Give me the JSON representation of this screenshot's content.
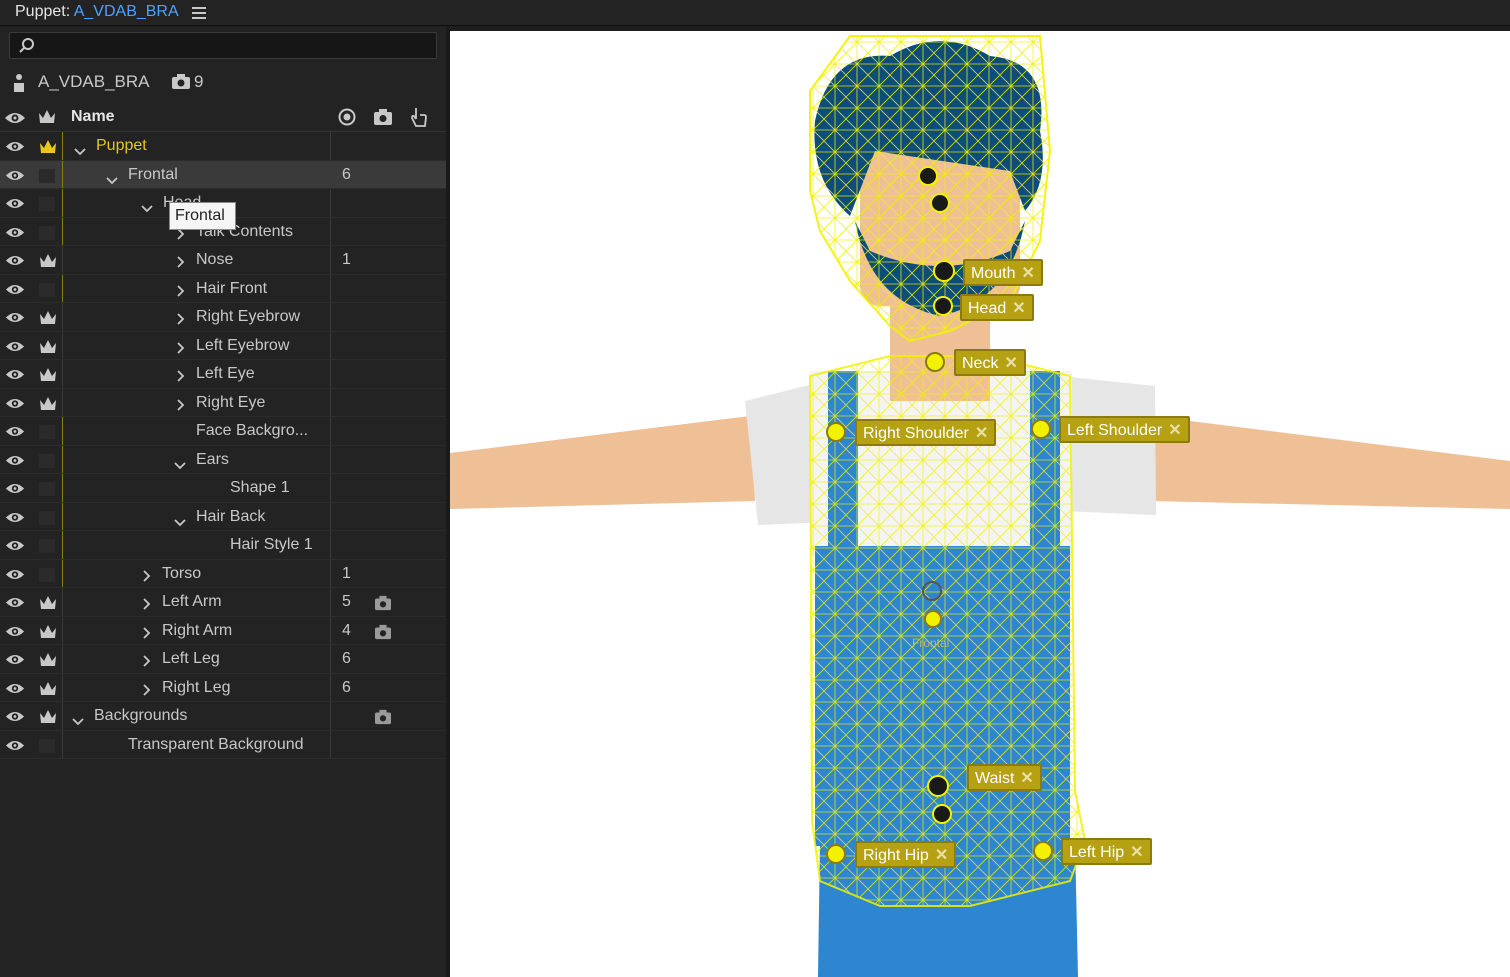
{
  "titlebar": {
    "prefix": "Puppet:",
    "puppet_name": "A_VDAB_BRA"
  },
  "search": {
    "placeholder": ""
  },
  "puppet_info": {
    "name": "A_VDAB_BRA",
    "camera_count": "9"
  },
  "header": {
    "name_label": "Name"
  },
  "rows": [
    {
      "label": "Puppet",
      "num": ""
    },
    {
      "label": "Frontal",
      "num": "6"
    },
    {
      "label": "Head",
      "num": ""
    },
    {
      "label": "Talk Contents",
      "num": ""
    },
    {
      "label": "Nose",
      "num": "1"
    },
    {
      "label": "Hair Front",
      "num": ""
    },
    {
      "label": "Right Eyebrow",
      "num": ""
    },
    {
      "label": "Left Eyebrow",
      "num": ""
    },
    {
      "label": "Left Eye",
      "num": ""
    },
    {
      "label": "Right Eye",
      "num": ""
    },
    {
      "label": "Face Backgro...",
      "num": ""
    },
    {
      "label": "Ears",
      "num": ""
    },
    {
      "label": "Shape 1",
      "num": ""
    },
    {
      "label": "Hair Back",
      "num": ""
    },
    {
      "label": "Hair Style 1",
      "num": ""
    },
    {
      "label": "Torso",
      "num": "1"
    },
    {
      "label": "Left Arm",
      "num": "5"
    },
    {
      "label": "Right Arm",
      "num": "4"
    },
    {
      "label": "Left Leg",
      "num": "6"
    },
    {
      "label": "Right Leg",
      "num": "6"
    },
    {
      "label": "Backgrounds",
      "num": ""
    },
    {
      "label": "Transparent Background",
      "num": ""
    }
  ],
  "tooltip": "Frontal",
  "handles": {
    "mouth": "Mouth",
    "head": "Head",
    "neck": "Neck",
    "right_shoulder": "Right Shoulder",
    "left_shoulder": "Left Shoulder",
    "waist": "Waist",
    "right_hip": "Right Hip",
    "left_hip": "Left Hip",
    "close_glyph": "✕"
  },
  "scene_labels": {
    "frontal": "Frontal"
  },
  "colors": {
    "accent_yellow": "#e8c61a",
    "link_blue": "#4aa3ff",
    "mesh": "#f2f200",
    "overalls": "#2d86cf"
  }
}
